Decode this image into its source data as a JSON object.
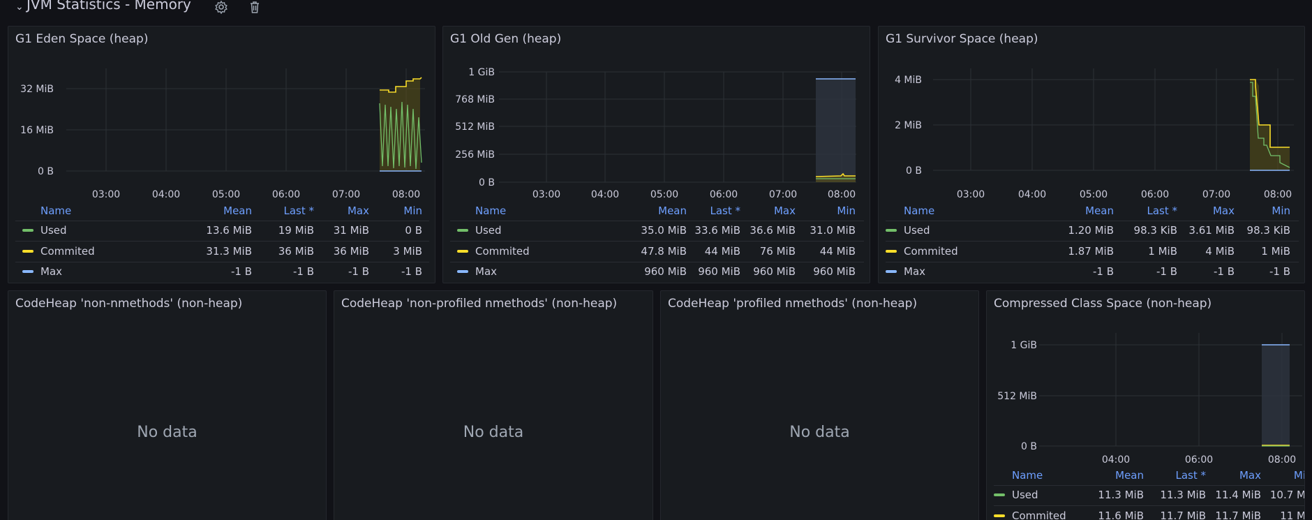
{
  "row": {
    "title": "JVM Statistics - Memory"
  },
  "legend_headers": [
    "Name",
    "Mean",
    "Last *",
    "Max",
    "Min"
  ],
  "colors": {
    "used": "#73bf69",
    "committed": "#fade2a",
    "max": "#8ab8ff"
  },
  "panels": [
    {
      "title": "G1 Eden Space (heap)",
      "y_ticks": [
        "32 MiB",
        "16 MiB",
        "0 B"
      ],
      "x_ticks": [
        "03:00",
        "04:00",
        "05:00",
        "06:00",
        "07:00",
        "08:00"
      ],
      "rows": [
        {
          "name": "Used",
          "mean": "13.6 MiB",
          "last": "19 MiB",
          "max": "31 MiB",
          "min": "0 B"
        },
        {
          "name": "Commited",
          "mean": "31.3 MiB",
          "last": "36 MiB",
          "max": "36 MiB",
          "min": "3 MiB"
        },
        {
          "name": "Max",
          "mean": "-1 B",
          "last": "-1 B",
          "max": "-1 B",
          "min": "-1 B"
        }
      ]
    },
    {
      "title": "G1 Old Gen (heap)",
      "y_ticks": [
        "1 GiB",
        "768 MiB",
        "512 MiB",
        "256 MiB",
        "0 B"
      ],
      "x_ticks": [
        "03:00",
        "04:00",
        "05:00",
        "06:00",
        "07:00",
        "08:00"
      ],
      "rows": [
        {
          "name": "Used",
          "mean": "35.0 MiB",
          "last": "33.6 MiB",
          "max": "36.6 MiB",
          "min": "31.0 MiB"
        },
        {
          "name": "Commited",
          "mean": "47.8 MiB",
          "last": "44 MiB",
          "max": "76 MiB",
          "min": "44 MiB"
        },
        {
          "name": "Max",
          "mean": "960 MiB",
          "last": "960 MiB",
          "max": "960 MiB",
          "min": "960 MiB"
        }
      ]
    },
    {
      "title": "G1 Survivor Space (heap)",
      "y_ticks": [
        "4 MiB",
        "2 MiB",
        "0 B"
      ],
      "x_ticks": [
        "03:00",
        "04:00",
        "05:00",
        "06:00",
        "07:00",
        "08:00"
      ],
      "rows": [
        {
          "name": "Used",
          "mean": "1.20 MiB",
          "last": "98.3 KiB",
          "max": "3.61 MiB",
          "min": "98.3 KiB"
        },
        {
          "name": "Commited",
          "mean": "1.87 MiB",
          "last": "1 MiB",
          "max": "4 MiB",
          "min": "1 MiB"
        },
        {
          "name": "Max",
          "mean": "-1 B",
          "last": "-1 B",
          "max": "-1 B",
          "min": "-1 B"
        }
      ]
    },
    {
      "title": "CodeHeap 'non-nmethods' (non-heap)",
      "nodata": "No data"
    },
    {
      "title": "CodeHeap 'non-profiled nmethods' (non-heap)",
      "nodata": "No data"
    },
    {
      "title": "CodeHeap 'profiled nmethods' (non-heap)",
      "nodata": "No data"
    },
    {
      "title": "Compressed Class Space (non-heap)",
      "y_ticks": [
        "1 GiB",
        "512 MiB",
        "0 B"
      ],
      "x_ticks": [
        "04:00",
        "06:00",
        "08:00"
      ],
      "legend_headers": [
        "Name",
        "Mean",
        "Last *",
        "Max",
        "Mi"
      ],
      "rows": [
        {
          "name": "Used",
          "mean": "11.3 MiB",
          "last": "11.3 MiB",
          "max": "11.4 MiB",
          "min": "10.7 M"
        },
        {
          "name": "Commited",
          "mean": "11.6 MiB",
          "last": "11.7 MiB",
          "max": "11.7 MiB",
          "min": "11 M"
        }
      ]
    }
  ]
}
